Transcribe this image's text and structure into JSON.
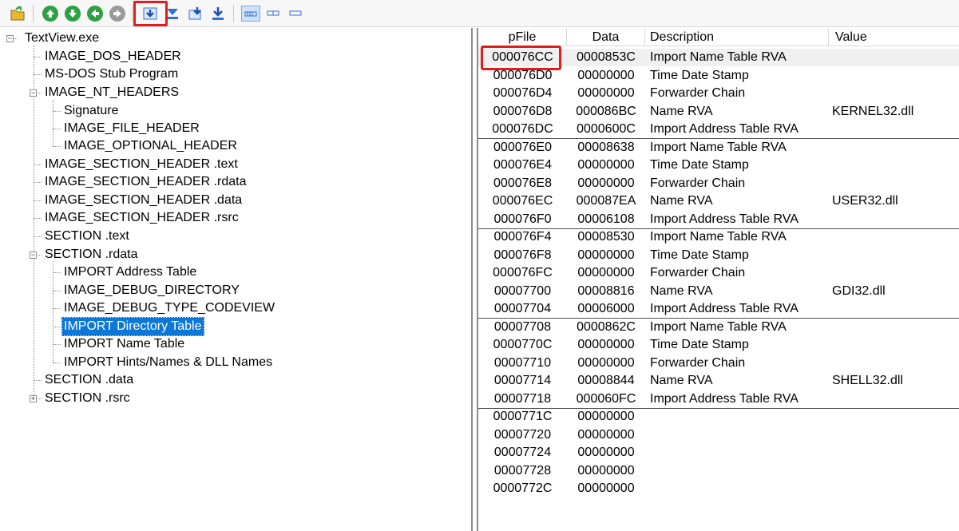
{
  "toolbar": {
    "buttons": [
      "open-file",
      "go-up",
      "go-down",
      "go-back",
      "go-forward",
      "view-import-directory",
      "view-import-filter",
      "view-import-names",
      "view-import-hints",
      "view-wide",
      "view-medium",
      "view-narrow"
    ]
  },
  "tree": {
    "items": [
      {
        "label": "TextView.exe"
      },
      {
        "label": "IMAGE_DOS_HEADER"
      },
      {
        "label": "MS-DOS Stub Program"
      },
      {
        "label": "IMAGE_NT_HEADERS"
      },
      {
        "label": "Signature"
      },
      {
        "label": "IMAGE_FILE_HEADER"
      },
      {
        "label": "IMAGE_OPTIONAL_HEADER"
      },
      {
        "label": "IMAGE_SECTION_HEADER .text"
      },
      {
        "label": "IMAGE_SECTION_HEADER .rdata"
      },
      {
        "label": "IMAGE_SECTION_HEADER .data"
      },
      {
        "label": "IMAGE_SECTION_HEADER .rsrc"
      },
      {
        "label": "SECTION .text"
      },
      {
        "label": "SECTION .rdata"
      },
      {
        "label": "IMPORT Address Table"
      },
      {
        "label": "IMAGE_DEBUG_DIRECTORY"
      },
      {
        "label": "IMAGE_DEBUG_TYPE_CODEVIEW"
      },
      {
        "label": "IMPORT Directory Table"
      },
      {
        "label": "IMPORT Name Table"
      },
      {
        "label": "IMPORT Hints/Names & DLL Names"
      },
      {
        "label": "SECTION .data"
      },
      {
        "label": "SECTION .rsrc"
      }
    ]
  },
  "table": {
    "columns": {
      "pfile": "pFile",
      "data": "Data",
      "description": "Description",
      "value": "Value"
    },
    "rows": [
      {
        "pfile": "000076CC",
        "data": "0000853C",
        "description": "Import Name Table RVA",
        "value": ""
      },
      {
        "pfile": "000076D0",
        "data": "00000000",
        "description": "Time Date Stamp",
        "value": ""
      },
      {
        "pfile": "000076D4",
        "data": "00000000",
        "description": "Forwarder Chain",
        "value": ""
      },
      {
        "pfile": "000076D8",
        "data": "000086BC",
        "description": "Name RVA",
        "value": "KERNEL32.dll"
      },
      {
        "pfile": "000076DC",
        "data": "0000600C",
        "description": "Import Address Table RVA",
        "value": ""
      },
      {
        "pfile": "000076E0",
        "data": "00008638",
        "description": "Import Name Table RVA",
        "value": ""
      },
      {
        "pfile": "000076E4",
        "data": "00000000",
        "description": "Time Date Stamp",
        "value": ""
      },
      {
        "pfile": "000076E8",
        "data": "00000000",
        "description": "Forwarder Chain",
        "value": ""
      },
      {
        "pfile": "000076EC",
        "data": "000087EA",
        "description": "Name RVA",
        "value": "USER32.dll"
      },
      {
        "pfile": "000076F0",
        "data": "00006108",
        "description": "Import Address Table RVA",
        "value": ""
      },
      {
        "pfile": "000076F4",
        "data": "00008530",
        "description": "Import Name Table RVA",
        "value": ""
      },
      {
        "pfile": "000076F8",
        "data": "00000000",
        "description": "Time Date Stamp",
        "value": ""
      },
      {
        "pfile": "000076FC",
        "data": "00000000",
        "description": "Forwarder Chain",
        "value": ""
      },
      {
        "pfile": "00007700",
        "data": "00008816",
        "description": "Name RVA",
        "value": "GDI32.dll"
      },
      {
        "pfile": "00007704",
        "data": "00006000",
        "description": "Import Address Table RVA",
        "value": ""
      },
      {
        "pfile": "00007708",
        "data": "0000862C",
        "description": "Import Name Table RVA",
        "value": ""
      },
      {
        "pfile": "0000770C",
        "data": "00000000",
        "description": "Time Date Stamp",
        "value": ""
      },
      {
        "pfile": "00007710",
        "data": "00000000",
        "description": "Forwarder Chain",
        "value": ""
      },
      {
        "pfile": "00007714",
        "data": "00008844",
        "description": "Name RVA",
        "value": "SHELL32.dll"
      },
      {
        "pfile": "00007718",
        "data": "000060FC",
        "description": "Import Address Table RVA",
        "value": ""
      },
      {
        "pfile": "0000771C",
        "data": "00000000",
        "description": "",
        "value": ""
      },
      {
        "pfile": "00007720",
        "data": "00000000",
        "description": "",
        "value": ""
      },
      {
        "pfile": "00007724",
        "data": "00000000",
        "description": "",
        "value": ""
      },
      {
        "pfile": "00007728",
        "data": "00000000",
        "description": "",
        "value": ""
      },
      {
        "pfile": "0000772C",
        "data": "00000000",
        "description": "",
        "value": ""
      }
    ]
  },
  "colors": {
    "selection": "#0b78d7",
    "highlight": "#e21b1b",
    "toolbar_green": "#2ea043",
    "toolbar_blue": "#2f6fd6"
  }
}
